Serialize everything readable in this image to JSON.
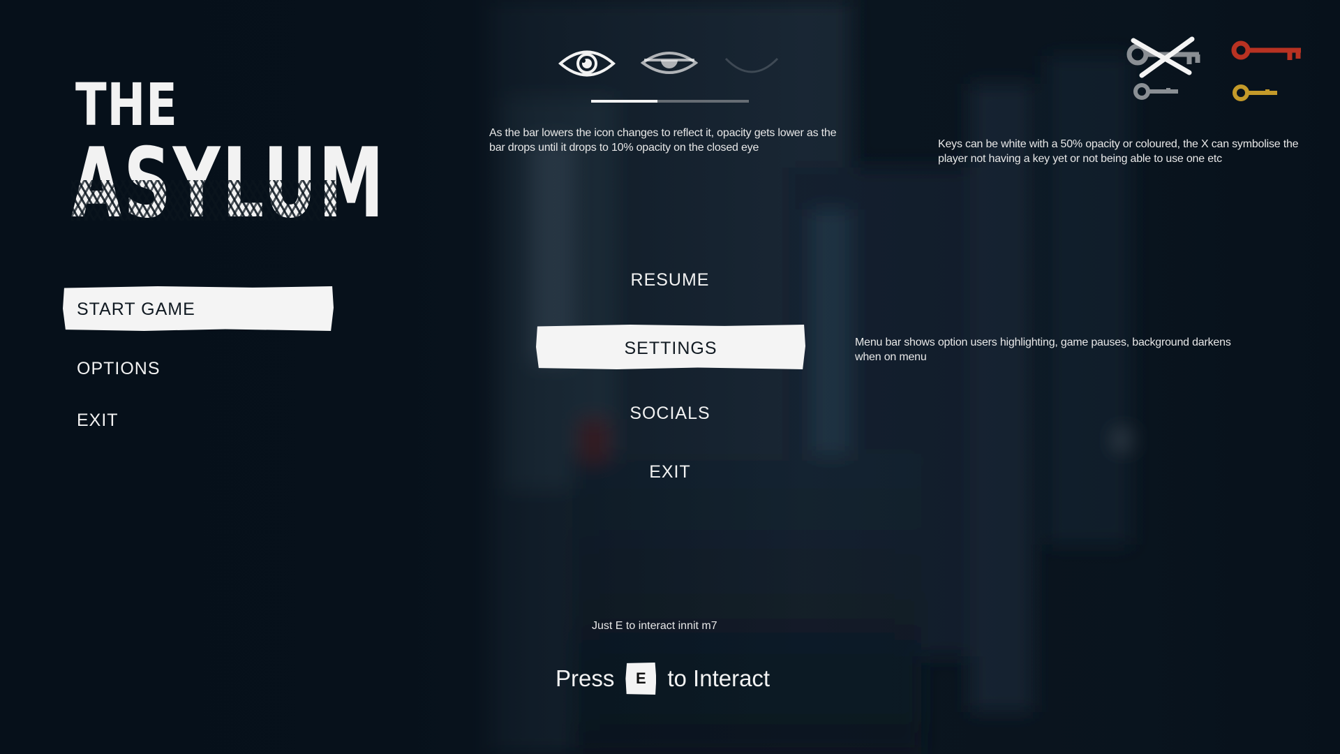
{
  "logo": {
    "line1": "THE",
    "line2": "ASYLUM"
  },
  "main_menu": {
    "items": [
      {
        "label": "START GAME",
        "highlighted": true
      },
      {
        "label": "OPTIONS",
        "highlighted": false
      },
      {
        "label": "EXIT",
        "highlighted": false
      }
    ]
  },
  "pause_menu": {
    "items": [
      {
        "label": "RESUME",
        "highlighted": false
      },
      {
        "label": "SETTINGS",
        "highlighted": true
      },
      {
        "label": "SOCIALS",
        "highlighted": false
      },
      {
        "label": "EXIT",
        "highlighted": false
      }
    ]
  },
  "visibility_indicator": {
    "icons": [
      "eye-open-icon",
      "eye-half-closed-icon",
      "eye-closed-icon"
    ],
    "bar_fill_percent": 42
  },
  "keys": {
    "icons": [
      {
        "name": "key-crossed-icon",
        "color": "#8a8f94",
        "crossed": true
      },
      {
        "name": "key-red-icon",
        "color": "#b83222"
      },
      {
        "name": "key-grey-icon",
        "color": "#8a8f94"
      },
      {
        "name": "key-gold-icon",
        "color": "#c49a2a"
      }
    ]
  },
  "notes": {
    "eye": "As the bar lowers the icon changes to reflect it, opacity gets lower as the bar drops until it drops to 10% opacity on the closed eye",
    "keys": "Keys can be white with a 50% opacity or coloured, the X can symbolise the player not having a key yet or not being able to use one etc",
    "menu": "Menu bar shows option users highlighting, game pauses, background darkens when on menu",
    "interact": "Just E to interact innit m7"
  },
  "prompt": {
    "before": "Press",
    "key": "E",
    "after": "to Interact"
  },
  "colors": {
    "background": "#0a141d",
    "highlight": "#f4f4f4",
    "highlight_text": "#111a22"
  }
}
